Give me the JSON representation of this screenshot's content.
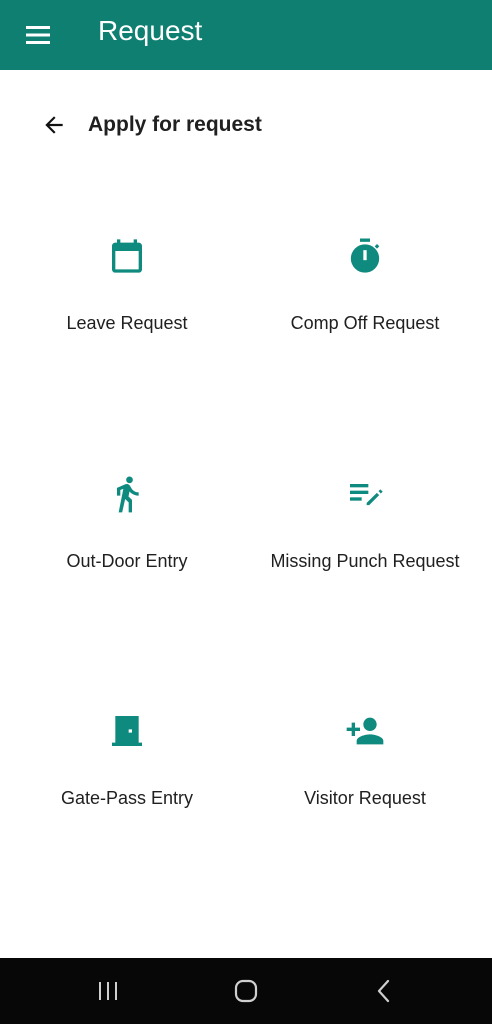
{
  "appbar": {
    "title": "Request",
    "menu_icon": "menu-icon",
    "color": "#0f7f72"
  },
  "subheader": {
    "title": "Apply for request",
    "back_icon": "arrow-back-icon"
  },
  "tiles": [
    {
      "label": "Leave Request",
      "icon": "calendar-icon"
    },
    {
      "label": "Comp Off Request",
      "icon": "timer-icon"
    },
    {
      "label": "Out-Door Entry",
      "icon": "walking-person-icon"
    },
    {
      "label": "Missing Punch Request",
      "icon": "edit-note-icon"
    },
    {
      "label": "Gate-Pass Entry",
      "icon": "door-icon"
    },
    {
      "label": "Visitor Request",
      "icon": "person-add-icon"
    }
  ],
  "accent_color": "#0f8a7e",
  "navbar": {
    "recent_icon": "recent-apps-icon",
    "home_icon": "home-icon",
    "back_icon": "nav-back-icon"
  }
}
